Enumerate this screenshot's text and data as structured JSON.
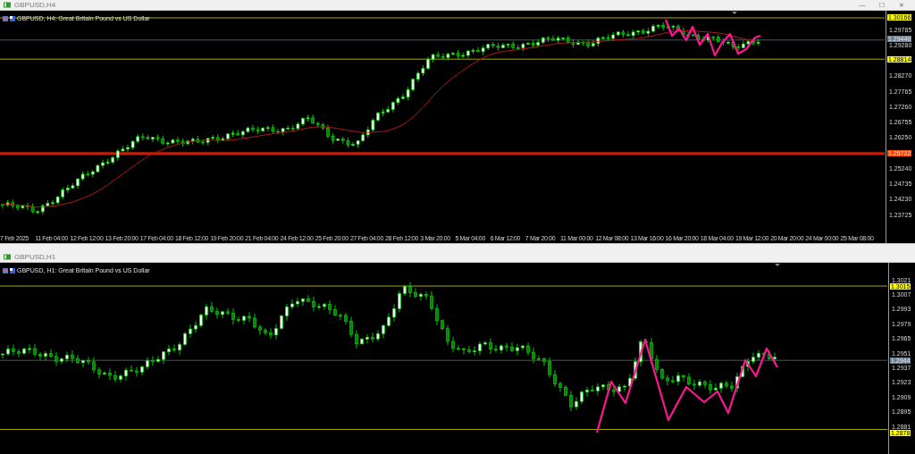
{
  "windows": [
    {
      "title": "GBPUSD,H4",
      "controls": [
        "—",
        "☐",
        "✕"
      ],
      "chart_title": "GBPUSD, H4:  Great Britain Pound vs US Dollar",
      "price_ticks": [
        "1.29785",
        "1.29280",
        "1.28270",
        "1.27765",
        "1.27260",
        "1.26755",
        "1.26250",
        "1.25240",
        "1.24735",
        "1.24230",
        "1.23725"
      ],
      "price_markers": [
        {
          "label": "1.30166",
          "color": "#ffff00",
          "kind": "line"
        },
        {
          "label": "1.29440",
          "color": "#708090",
          "kind": "line"
        },
        {
          "label": "1.28814",
          "color": "#ffff00",
          "kind": "line"
        },
        {
          "label": "1.25722",
          "color": "#ff4500",
          "kind": "band"
        }
      ],
      "time_labels": [
        "7 Feb 2025",
        "11 Feb 04:00",
        "12 Feb 12:00",
        "13 Feb 20:00",
        "17 Feb 04:00",
        "18 Feb 12:00",
        "19 Feb 20:00",
        "21 Feb 04:00",
        "24 Feb 12:00",
        "25 Feb 20:00",
        "27 Feb 04:00",
        "28 Feb 12:00",
        "3 Mar 20:00",
        "5 Mar 04:00",
        "6 Mar 12:00",
        "7 Mar 20:00",
        "11 Mar 00:00",
        "12 Mar 08:00",
        "13 Mar 16:00",
        "16 Mar 20:00",
        "18 Mar 04:00",
        "19 Mar 12:00",
        "20 Mar 20:00",
        "24 Mar 00:00",
        "25 Mar 08:00"
      ]
    },
    {
      "title": "GBPUSD,H1",
      "chart_title": "GBPUSD, H1:  Great Britain Pound vs US Dollar",
      "price_ticks": [
        "1.3021",
        "1.3007",
        "1.2993",
        "1.2979",
        "1.2965",
        "1.2951",
        "1.2937",
        "1.2923",
        "1.2909",
        "1.2895",
        "1.2881"
      ],
      "price_markers": [
        {
          "label": "1.3015",
          "color": "#ffff00",
          "kind": "line"
        },
        {
          "label": "1.2944",
          "color": "#708090",
          "kind": "line"
        },
        {
          "label": "1.2878",
          "color": "#ffff00",
          "kind": "line"
        }
      ]
    }
  ]
}
